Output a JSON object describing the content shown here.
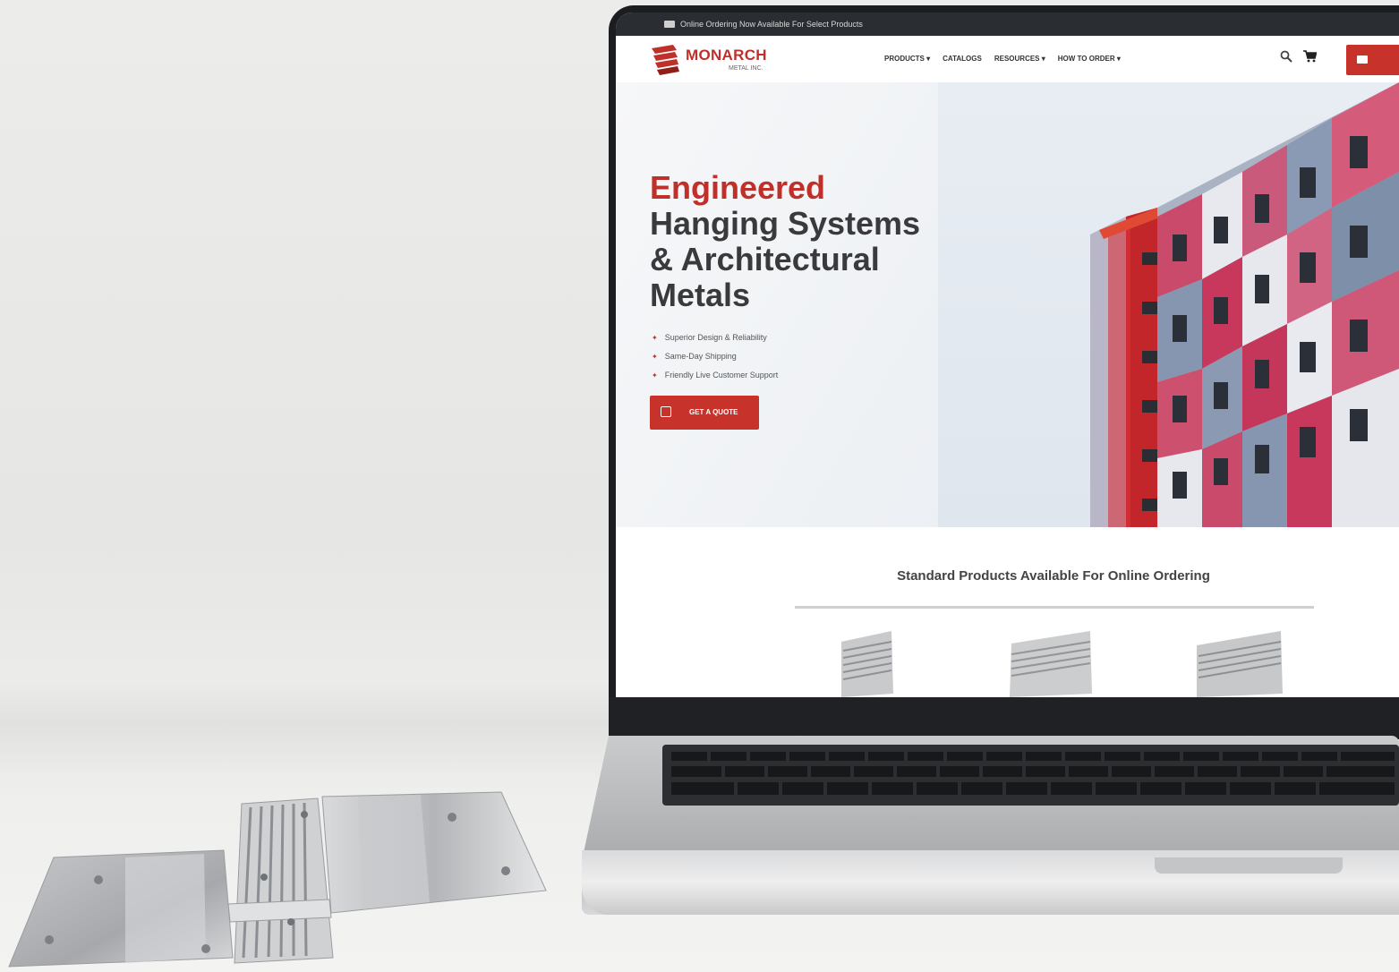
{
  "announcement": {
    "text": "Online Ordering Now Available For Select Products"
  },
  "brand": {
    "name": "MONARCH",
    "sub": "METAL INC."
  },
  "nav": {
    "items": [
      "PRODUCTS ▾",
      "CATALOGS",
      "RESOURCES ▾",
      "HOW TO ORDER ▾"
    ]
  },
  "hero": {
    "title_accent": "Engineered",
    "title_lines": [
      "Hanging Systems",
      "& Architectural",
      "Metals"
    ],
    "bullets": [
      "Superior Design & Reliability",
      "Same-Day Shipping",
      "Friendly Live Customer Support"
    ],
    "cta_label": "GET A QUOTE"
  },
  "products_section": {
    "title": "Standard Products Available For Online Ordering"
  },
  "colors": {
    "brand_red": "#c7322b",
    "dark_bar": "#2a2d31",
    "heading": "#3a3a3c"
  },
  "icons": {
    "search": "search-icon",
    "cart": "cart-icon",
    "email": "envelope-icon",
    "calendar": "calendar-icon"
  }
}
